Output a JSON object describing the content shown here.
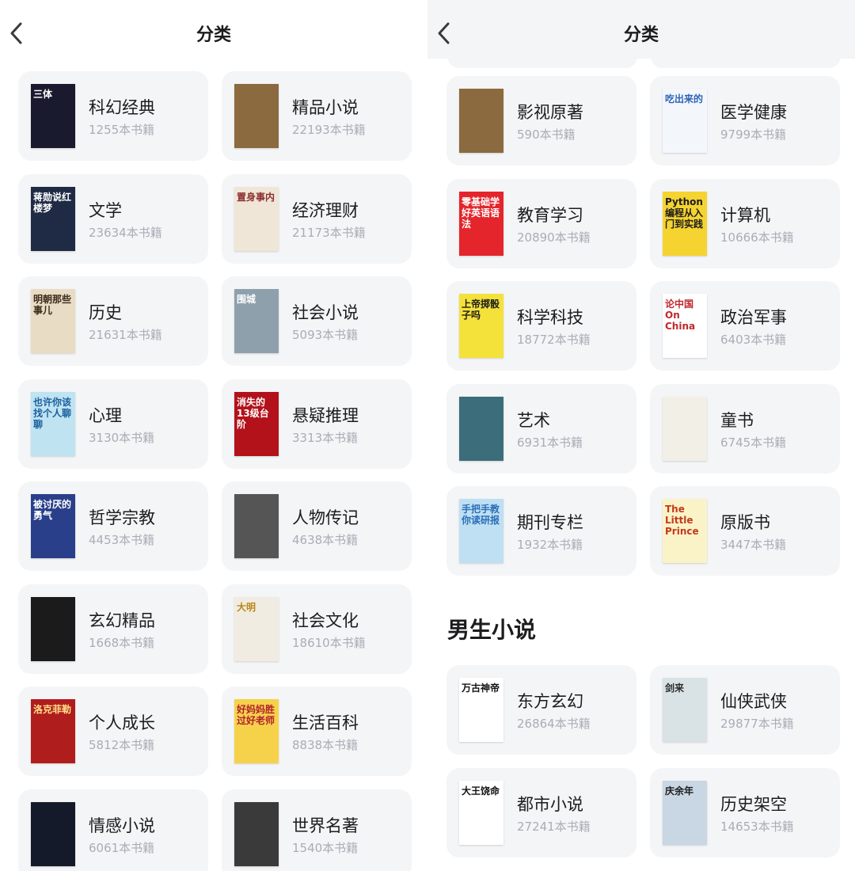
{
  "left_screen": {
    "header": {
      "title": "分类"
    },
    "categories": [
      {
        "name": "科幻经典",
        "count": "1255本书籍",
        "cover_bg": "#1a1a2e",
        "cover_fg": "#ffffff",
        "cover_text": "三体"
      },
      {
        "name": "精品小说",
        "count": "22193本书籍",
        "cover_bg": "#8a6a3e",
        "cover_fg": "#ffffff",
        "cover_text": ""
      },
      {
        "name": "文学",
        "count": "23634本书籍",
        "cover_bg": "#1f2a44",
        "cover_fg": "#ffffff",
        "cover_text": "蒋勋说红楼梦"
      },
      {
        "name": "经济理财",
        "count": "21173本书籍",
        "cover_bg": "#efe6d8",
        "cover_fg": "#8b2f2f",
        "cover_text": "置身事内"
      },
      {
        "name": "历史",
        "count": "21631本书籍",
        "cover_bg": "#e9dcc4",
        "cover_fg": "#3a2a1a",
        "cover_text": "明朝那些事儿"
      },
      {
        "name": "社会小说",
        "count": "5093本书籍",
        "cover_bg": "#8fa0ad",
        "cover_fg": "#ffffff",
        "cover_text": "围城"
      },
      {
        "name": "心理",
        "count": "3130本书籍",
        "cover_bg": "#bfe3f0",
        "cover_fg": "#1a5fa0",
        "cover_text": "也许你该找个人聊聊"
      },
      {
        "name": "悬疑推理",
        "count": "3313本书籍",
        "cover_bg": "#b3121b",
        "cover_fg": "#ffffff",
        "cover_text": "消失的13级台阶"
      },
      {
        "name": "哲学宗教",
        "count": "4453本书籍",
        "cover_bg": "#2a3f8a",
        "cover_fg": "#ffffff",
        "cover_text": "被讨厌的勇气"
      },
      {
        "name": "人物传记",
        "count": "4638本书籍",
        "cover_bg": "#555555",
        "cover_fg": "#ffffff",
        "cover_text": ""
      },
      {
        "name": "玄幻精品",
        "count": "1668本书籍",
        "cover_bg": "#1b1b1b",
        "cover_fg": "#e8c36a",
        "cover_text": ""
      },
      {
        "name": "社会文化",
        "count": "18610本书籍",
        "cover_bg": "#f1ece2",
        "cover_fg": "#b8871b",
        "cover_text": "大明"
      },
      {
        "name": "个人成长",
        "count": "5812本书籍",
        "cover_bg": "#b01d1d",
        "cover_fg": "#ffe08a",
        "cover_text": "洛克菲勒"
      },
      {
        "name": "生活百科",
        "count": "8838本书籍",
        "cover_bg": "#f6d24a",
        "cover_fg": "#b11f2f",
        "cover_text": "好妈妈胜过好老师"
      },
      {
        "name": "情感小说",
        "count": "6061本书籍",
        "cover_bg": "#151a2b",
        "cover_fg": "#ffffff",
        "cover_text": ""
      },
      {
        "name": "世界名著",
        "count": "1540本书籍",
        "cover_bg": "#3a3a3a",
        "cover_fg": "#e6d6c0",
        "cover_text": ""
      }
    ]
  },
  "right_screen": {
    "header": {
      "title": "分类"
    },
    "categories": [
      {
        "name": "影视原著",
        "count": "590本书籍",
        "cover_bg": "#8a6a3e",
        "cover_fg": "#ffffff",
        "cover_text": ""
      },
      {
        "name": "医学健康",
        "count": "9799本书籍",
        "cover_bg": "#f3f6fb",
        "cover_fg": "#2b63b8",
        "cover_text": "吃出来的"
      },
      {
        "name": "教育学习",
        "count": "20890本书籍",
        "cover_bg": "#e4252b",
        "cover_fg": "#ffffff",
        "cover_text": "零基础学好英语语法"
      },
      {
        "name": "计算机",
        "count": "10666本书籍",
        "cover_bg": "#f5d331",
        "cover_fg": "#1c1c1c",
        "cover_text": "Python编程从入门到实践"
      },
      {
        "name": "科学科技",
        "count": "18772本书籍",
        "cover_bg": "#f4e23a",
        "cover_fg": "#1c1c1c",
        "cover_text": "上帝掷骰子吗"
      },
      {
        "name": "政治军事",
        "count": "6403本书籍",
        "cover_bg": "#ffffff",
        "cover_fg": "#c0282d",
        "cover_text": "论中国 On China"
      },
      {
        "name": "艺术",
        "count": "6931本书籍",
        "cover_bg": "#3b6d7a",
        "cover_fg": "#ffffff",
        "cover_text": ""
      },
      {
        "name": "童书",
        "count": "6745本书籍",
        "cover_bg": "#f2efe6",
        "cover_fg": "#3a6a3a",
        "cover_text": ""
      },
      {
        "name": "期刊专栏",
        "count": "1932本书籍",
        "cover_bg": "#bfe0f3",
        "cover_fg": "#2a6fb8",
        "cover_text": "手把手教你读研报"
      },
      {
        "name": "原版书",
        "count": "3447本书籍",
        "cover_bg": "#fbf3c8",
        "cover_fg": "#c23a1b",
        "cover_text": "The Little Prince"
      }
    ],
    "section_title": "男生小说",
    "male_categories": [
      {
        "name": "东方玄幻",
        "count": "26864本书籍",
        "cover_bg": "#ffffff",
        "cover_fg": "#111111",
        "cover_text": "万古神帝"
      },
      {
        "name": "仙侠武侠",
        "count": "29877本书籍",
        "cover_bg": "#d9e2e4",
        "cover_fg": "#2a2a2a",
        "cover_text": "剑来"
      },
      {
        "name": "都市小说",
        "count": "27241本书籍",
        "cover_bg": "#ffffff",
        "cover_fg": "#111111",
        "cover_text": "大王饶命"
      },
      {
        "name": "历史架空",
        "count": "14653本书籍",
        "cover_bg": "#c9d6e3",
        "cover_fg": "#1c1c1c",
        "cover_text": "庆余年"
      }
    ]
  },
  "icons": {
    "back": "chevron-left-icon"
  }
}
